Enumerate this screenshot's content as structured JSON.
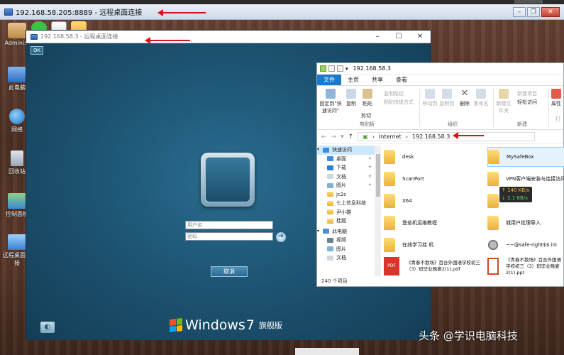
{
  "outer_window": {
    "title": "192.168.58.205:8889 - 远程桌面连接"
  },
  "desktop_icons": [
    {
      "label": "Administ"
    },
    {
      "label": "此电脑"
    },
    {
      "label": "网络"
    },
    {
      "label": "回收站"
    },
    {
      "label": "控制面板"
    },
    {
      "label": "远程桌面连接"
    }
  ],
  "inner_window": {
    "title": "192.168.58.3 - 远程桌面连接",
    "ok_label": "OK",
    "username_placeholder": "用户名",
    "password_placeholder": "密码",
    "cancel_label": "取消",
    "brand_word": "Windows",
    "brand_version": "7",
    "brand_edition": "旗舰版"
  },
  "explorer": {
    "title": "192.168.58.3",
    "tabs": [
      "文件",
      "主页",
      "共享",
      "查看"
    ],
    "ribbon": {
      "pin_label": "固定到\"快速访问\"",
      "copy_label": "复制",
      "paste_label": "粘贴",
      "cut_label": "剪切",
      "copy_path_label": "复制路径",
      "paste_shortcut_label": "粘贴快捷方式",
      "move_to_label": "移动到",
      "copy_to_label": "复制到",
      "delete_label": "删除",
      "rename_label": "重命名",
      "new_folder_label": "新建文件夹",
      "new_item_label": "新建项目",
      "easy_access_label": "轻松访问",
      "properties_label": "属性",
      "open_label": "打",
      "group_clipboard": "剪贴板",
      "group_organize": "组织",
      "group_new": "新建"
    },
    "address": {
      "part1": "Internet",
      "part2": "192.168.58.3"
    },
    "nav_items": [
      {
        "label": "快速访问",
        "pinned": false
      },
      {
        "label": "桌面",
        "pinned": true
      },
      {
        "label": "下载",
        "pinned": true
      },
      {
        "label": "文档",
        "pinned": true
      },
      {
        "label": "图片",
        "pinned": true
      },
      {
        "label": "jc2s",
        "pinned": false
      },
      {
        "label": "七上信息科技",
        "pinned": false
      },
      {
        "label": "尹小雄",
        "pinned": false
      },
      {
        "label": "桂题",
        "pinned": false
      },
      {
        "label": "此电脑",
        "pinned": false
      },
      {
        "label": "视频",
        "pinned": false
      },
      {
        "label": "图片",
        "pinned": false
      },
      {
        "label": "文档",
        "pinned": false
      }
    ],
    "files_left": [
      {
        "name": "desk",
        "type": "folder"
      },
      {
        "name": "ScanPort",
        "type": "folder"
      },
      {
        "name": "X64",
        "type": "folder"
      },
      {
        "name": "堡垒机运维教程",
        "type": "folder"
      },
      {
        "name": "在线学习挂 机",
        "type": "folder"
      },
      {
        "name": "《青春不散场》百合外国语学校初三（3）班毕业晚宴2(1).pdf",
        "type": "pdf"
      }
    ],
    "files_right": [
      {
        "name": "MySafeBox",
        "type": "folder"
      },
      {
        "name": "VPN客户端安装与连接访问",
        "type": "folder"
      },
      {
        "name": "",
        "type": "folder"
      },
      {
        "name": "城用户批理导入",
        "type": "folder"
      },
      {
        "name": "~~@safe-right$$.ini",
        "type": "ini"
      },
      {
        "name": "《青春不散场》百合外国语学校初三（3）班毕业晚宴2(1).ppt",
        "type": "ppt"
      }
    ],
    "status": "240 个项目"
  },
  "speed_widget": {
    "up": "↑ 140 KB/s",
    "down": "↓ 2.1 KB/s"
  },
  "watermark": "头条 @学识电脑科技",
  "colors": {
    "arrow": "#d4161b",
    "rdp_bg": "#1f4e6a",
    "ribbon_file": "#1979ca"
  }
}
